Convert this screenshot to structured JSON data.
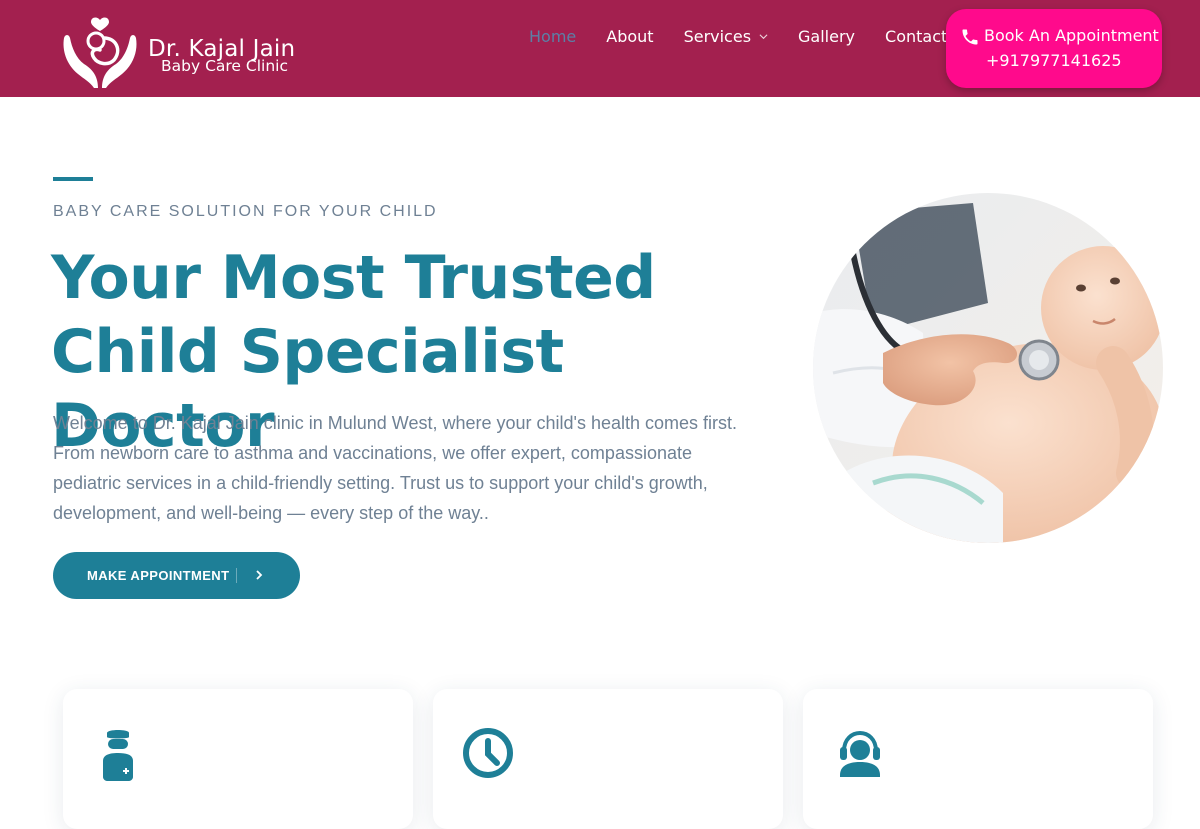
{
  "brand": {
    "name": "Dr. Kajal Jain",
    "tagline": "Baby Care Clinic"
  },
  "nav": {
    "items": [
      {
        "label": "Home",
        "active": true
      },
      {
        "label": "About"
      },
      {
        "label": "Services",
        "has_dropdown": true
      },
      {
        "label": "Gallery"
      },
      {
        "label": "Contact"
      }
    ]
  },
  "booking": {
    "label": "Book An Appointment",
    "phone": "+917977141625",
    "icon": "phone-icon"
  },
  "hero": {
    "eyebrow": "BABY CARE SOLUTION FOR YOUR CHILD",
    "title": "Your Most Trusted Child Specialist Doctor",
    "description": "Welcome to Dr. Kajal Jain clinic in Mulund West, where your child's health comes first. From newborn care to asthma and vaccinations, we offer expert, compassionate pediatric services in a child-friendly setting. Trust us to support your child's growth, development, and well-being — every step of the way..",
    "cta_label": "MAKE APPOINTMENT"
  },
  "cards": [
    {
      "icon": "doctor-icon"
    },
    {
      "icon": "clock-icon"
    },
    {
      "icon": "support-agent-icon"
    }
  ],
  "colors": {
    "header_bg": "#a3204f",
    "book_button": "#ff0a8c",
    "accent": "#1e7f97",
    "body_text": "#6f8194",
    "nav_active": "#5c7fa6"
  }
}
